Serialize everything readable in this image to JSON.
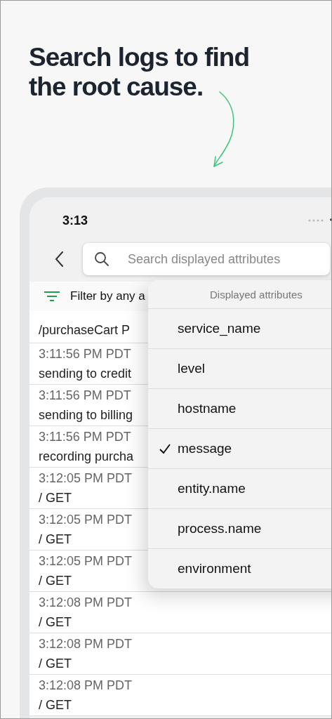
{
  "headline": "Search logs to find the root cause.",
  "status_bar": {
    "time": "3:13"
  },
  "search": {
    "placeholder": "Search displayed attributes"
  },
  "filter": {
    "label": "Filter by any a"
  },
  "logs": [
    {
      "message": "/purchaseCart P"
    },
    {
      "time": "3:11:56 PM PDT",
      "message": "sending to credit"
    },
    {
      "time": "3:11:56 PM PDT",
      "message": "sending to billing"
    },
    {
      "time": "3:11:56 PM PDT",
      "message": "recording purcha"
    },
    {
      "time": "3:12:05 PM PDT",
      "message": "/ GET"
    },
    {
      "time": "3:12:05 PM PDT",
      "message": "/ GET"
    },
    {
      "time": "3:12:05 PM PDT",
      "message": "/ GET"
    },
    {
      "time": "3:12:08 PM PDT",
      "message": "/ GET"
    },
    {
      "time": "3:12:08 PM PDT",
      "message": "/ GET"
    },
    {
      "time": "3:12:08 PM PDT",
      "message": "/ GET"
    }
  ],
  "dropdown": {
    "title": "Displayed attributes",
    "items": [
      {
        "label": "service_name",
        "checked": false
      },
      {
        "label": "level",
        "checked": false
      },
      {
        "label": "hostname",
        "checked": false
      },
      {
        "label": "message",
        "checked": true
      },
      {
        "label": "entity.name",
        "checked": false
      },
      {
        "label": "process.name",
        "checked": false
      },
      {
        "label": "environment",
        "checked": false
      }
    ]
  }
}
